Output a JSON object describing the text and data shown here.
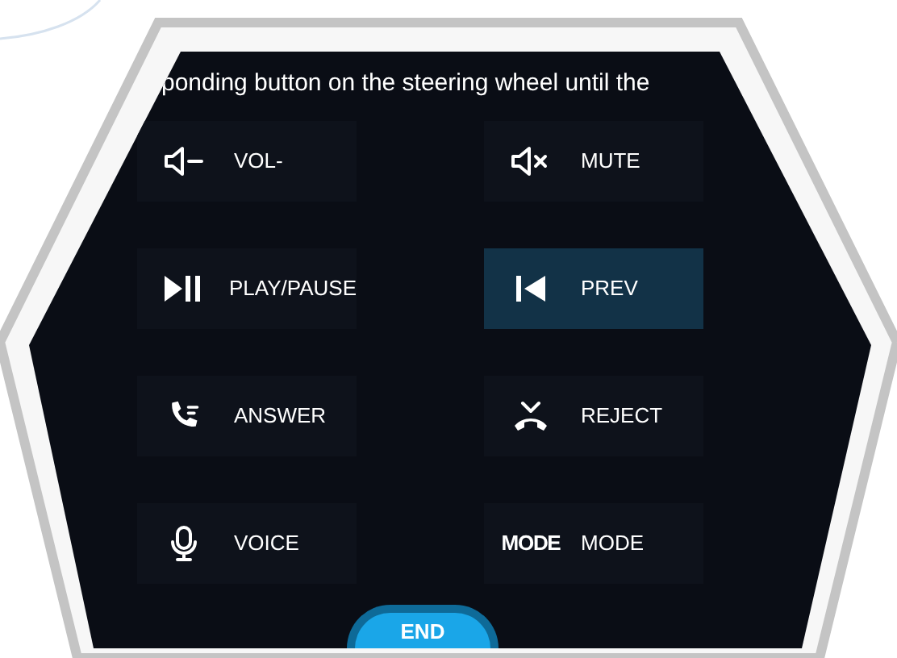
{
  "instruction": "ponding button on the steering wheel until the",
  "buttons": [
    {
      "kind": "vol-down",
      "label": "VOL-",
      "selected": false
    },
    {
      "kind": "mute",
      "label": "MUTE",
      "selected": false
    },
    {
      "kind": "play-pause",
      "label": "PLAY/PAUSE",
      "selected": false
    },
    {
      "kind": "prev",
      "label": "PREV",
      "selected": true
    },
    {
      "kind": "answer",
      "label": "ANSWER",
      "selected": false
    },
    {
      "kind": "reject",
      "label": "REJECT",
      "selected": false
    },
    {
      "kind": "voice",
      "label": "VOICE",
      "selected": false
    },
    {
      "kind": "text",
      "icon_text": "MODE",
      "label": "MODE",
      "selected": false
    }
  ],
  "end_button": {
    "label": "END"
  }
}
